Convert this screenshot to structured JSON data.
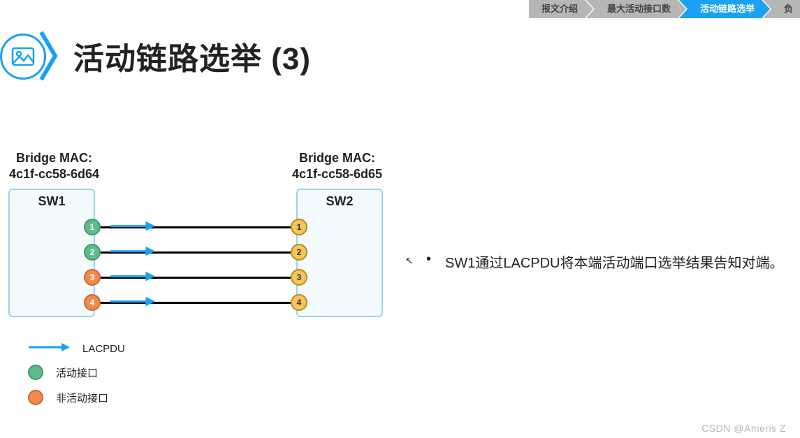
{
  "breadcrumb": {
    "items": [
      {
        "label": "报文介绍",
        "active": false
      },
      {
        "label": "最大活动接口数",
        "active": false
      },
      {
        "label": "活动链路选举",
        "active": true
      },
      {
        "label": "负",
        "active": false
      }
    ]
  },
  "title": {
    "text": "活动链路选举 (3)",
    "icon": "image-icon"
  },
  "diagram": {
    "sw1": {
      "name": "SW1",
      "mac_label": "Bridge MAC:",
      "mac_value": "4c1f-cc58-6d64"
    },
    "sw2": {
      "name": "SW2",
      "mac_label": "Bridge MAC:",
      "mac_value": "4c1f-cc58-6d65"
    },
    "links": [
      {
        "left_port": "1",
        "left_state": "active",
        "right_port": "1",
        "right_state": "warn",
        "arrow": true
      },
      {
        "left_port": "2",
        "left_state": "active",
        "right_port": "2",
        "right_state": "warn",
        "arrow": true
      },
      {
        "left_port": "3",
        "left_state": "inactive",
        "right_port": "3",
        "right_state": "warn",
        "arrow": true
      },
      {
        "left_port": "4",
        "left_state": "inactive",
        "right_port": "4",
        "right_state": "warn",
        "arrow": true
      }
    ],
    "arrow_meaning": "LACPDU"
  },
  "legend": {
    "lacpdu": "LACPDU",
    "active_port": "活动接口",
    "inactive_port": "非活动接口"
  },
  "description": {
    "bullets": [
      "SW1通过LACPDU将本端活动端口选举结果告知对端。"
    ]
  },
  "watermark": "CSDN @Ameris Z",
  "colors": {
    "accent": "#1BA1F2",
    "active_port": "#60BB8C",
    "inactive_port": "#F08A4E",
    "remote_port": "#F6C55B"
  }
}
